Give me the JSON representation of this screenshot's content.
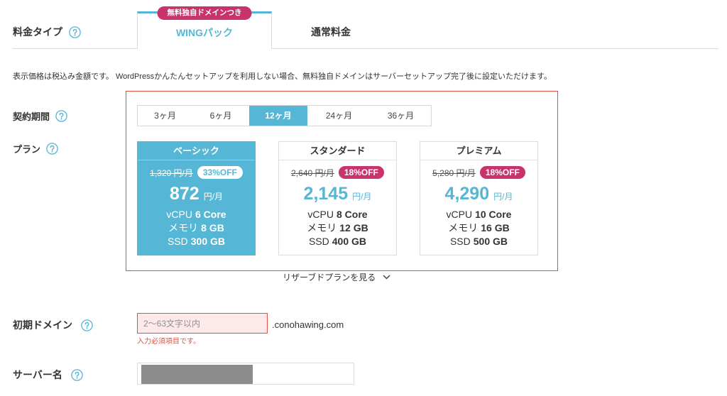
{
  "pricing_type": {
    "label": "料金タイプ",
    "help_icon": "help-icon",
    "tabs": [
      {
        "label": "WINGパック",
        "badge": "無料独自ドメインつき",
        "active": true
      },
      {
        "label": "通常料金",
        "active": false
      }
    ]
  },
  "notice": "表示価格は税込み金額です。 WordPressかんたんセットアップを利用しない場合、無料独自ドメインはサーバーセットアップ完了後に設定いただけます。",
  "contract_period": {
    "label": "契約期間",
    "help_icon": "help-icon",
    "options": [
      "3ヶ月",
      "6ヶ月",
      "12ヶ月",
      "24ヶ月",
      "36ヶ月"
    ],
    "selected": "12ヶ月"
  },
  "plan": {
    "label": "プラン",
    "help_icon": "help-icon",
    "cards": [
      {
        "name": "ベーシック",
        "original_price": "1,320 円/月",
        "discount": "33%OFF",
        "price": "872",
        "price_unit": "円/月",
        "specs": [
          {
            "label": "vCPU",
            "value": "6 Core"
          },
          {
            "label": "メモリ",
            "value": "8 GB"
          },
          {
            "label": "SSD",
            "value": "300 GB"
          }
        ],
        "selected": true
      },
      {
        "name": "スタンダード",
        "original_price": "2,640 円/月",
        "discount": "18%OFF",
        "price": "2,145",
        "price_unit": "円/月",
        "specs": [
          {
            "label": "vCPU",
            "value": "8 Core"
          },
          {
            "label": "メモリ",
            "value": "12 GB"
          },
          {
            "label": "SSD",
            "value": "400 GB"
          }
        ],
        "selected": false
      },
      {
        "name": "プレミアム",
        "original_price": "5,280 円/月",
        "discount": "18%OFF",
        "price": "4,290",
        "price_unit": "円/月",
        "specs": [
          {
            "label": "vCPU",
            "value": "10 Core"
          },
          {
            "label": "メモリ",
            "value": "16 GB"
          },
          {
            "label": "SSD",
            "value": "500 GB"
          }
        ],
        "selected": false
      }
    ]
  },
  "reserved_link": {
    "label": "リザーブドプランを見る",
    "icon": "chevron-down-icon"
  },
  "initial_domain": {
    "label": "初期ドメイン",
    "help_icon": "help-icon",
    "value": "",
    "placeholder": "2〜63文字以内",
    "suffix": ".conohawing.com",
    "error": "入力必須項目です。"
  },
  "server_name": {
    "label": "サーバー名",
    "help_icon": "help-icon"
  },
  "colors": {
    "accent": "#55b7d5",
    "badge": "#c8336c",
    "highlight": "#e2513f",
    "error": "#e2513f",
    "input_error_bg": "#fde9e9",
    "redaction": "#8c8c8c",
    "text": "#333333"
  }
}
